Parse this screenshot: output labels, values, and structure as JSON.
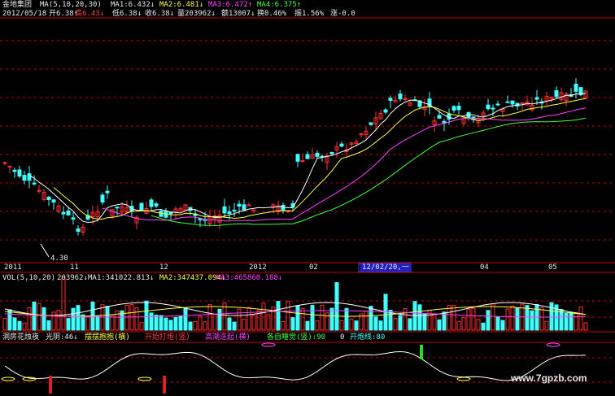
{
  "stock": {
    "name": "金地集团",
    "ma_label": "MA(5,10,20,30)",
    "ma1": "MA1:6.432↓",
    "ma2": "MA2:6.481↓",
    "ma3": "MA3:6.472↑",
    "ma4": "MA4:6.375↑"
  },
  "quote": {
    "date": "2012/05/18",
    "open": "开6.38↑",
    "high": "高6.43↓",
    "low": "低6.38↓",
    "close": "收6.38↓",
    "volume": "量203962↓",
    "amount": "额13007↓",
    "turnover": "换0.46%",
    "amplitude": "振1.56%",
    "change": "涨-0.0"
  },
  "low_marker": "4.30",
  "time_axis": {
    "ticks": [
      "2011",
      "11",
      "12",
      "2012",
      "02",
      "04",
      "05"
    ],
    "cursor": "12/02/20,一"
  },
  "volume_panel": {
    "label": "VOL(5,10,20)",
    "value": "203962↓",
    "ma1": "MA1:341022.813↓",
    "ma2": "MA2:347437.094↓",
    "ma3": "MA3:465860.188↓"
  },
  "indicator_panel": {
    "name": "洞房花烛夜",
    "line": "光阴:46↓",
    "s1": "摆摆抱抱(橫)",
    "s2": "开始打炮(竖)",
    "s3": "高潮迭起(横)",
    "s4": "各自睡觉(竖):90",
    "s5": "0",
    "s6": "开炮线:80"
  },
  "watermark": "www.7gpzb.com",
  "colors": {
    "up": "#ff3030",
    "down": "#40ffff",
    "ma1": "#ffffff",
    "ma2": "#ffff40",
    "ma3": "#ff40ff",
    "ma4": "#40ff40",
    "grid": "#c00000"
  }
}
